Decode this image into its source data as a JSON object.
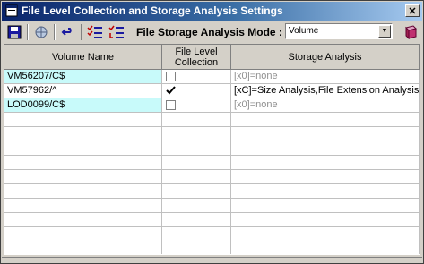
{
  "window": {
    "title": "File Level Collection and Storage Analysis Settings"
  },
  "toolbar": {
    "buttons": [
      {
        "name": "save-icon"
      },
      {
        "name": "globe-refresh-icon"
      },
      {
        "name": "undo-icon"
      },
      {
        "name": "checklist-icon"
      },
      {
        "name": "sort-checklist-icon"
      }
    ],
    "mode_label": "File Storage Analysis Mode :",
    "mode_value": "Volume",
    "help_icon": "book-icon"
  },
  "grid": {
    "columns": [
      "Volume Name",
      "File Level\nCollection",
      "Storage Analysis"
    ],
    "rows": [
      {
        "volume": "VM56207/C$",
        "collection": false,
        "analysis": "[x0]=none",
        "analysis_muted": true,
        "highlight": true
      },
      {
        "volume": "VM57962/^",
        "collection": true,
        "analysis": "[xC]=Size Analysis,File Extension Analysis",
        "analysis_muted": false,
        "highlight": false
      },
      {
        "volume": "LOD0099/C$",
        "collection": false,
        "analysis": "[x0]=none",
        "analysis_muted": true,
        "highlight": true
      }
    ],
    "empty_rows": 8
  },
  "colors": {
    "highlight": "#c8fafa",
    "title_start": "#0a246a",
    "title_end": "#a6caf0"
  }
}
